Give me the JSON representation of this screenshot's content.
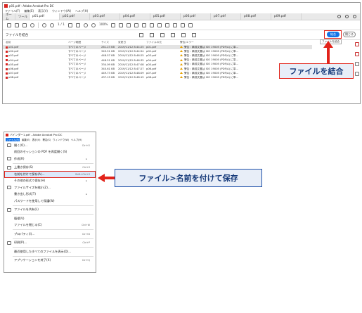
{
  "top": {
    "window_title": "p01.pdf - Adobe Acrobat Pro DC",
    "menu": [
      "ファイル(F)",
      "編集(E)",
      "表示(V)",
      "ウィンドウ(W)",
      "ヘルプ(H)"
    ],
    "tabs": [
      "ホーム",
      "ツール",
      "p01.pdf",
      "p02.pdf",
      "p03.pdf",
      "p04.pdf",
      "p05.pdf",
      "p06.pdf",
      "p07.pdf",
      "p08.pdf",
      "p09.pdf"
    ],
    "zoom": "100%",
    "page_indicator": "1 / 1",
    "combine_title": "ファイルを結合",
    "combine_button": "結合",
    "close_button": "閉じる",
    "tooltip": "ファイルを結合",
    "columns": [
      "名前",
      "ページ範囲",
      "サイズ",
      "変更日",
      "ファイルの元",
      "警告/エラー"
    ],
    "files": [
      {
        "name": "p01.pdf",
        "pages": "すべてのページ",
        "size": "261.23 KB",
        "modified": "2019/11/12 8:44:25",
        "origin": "p01.pdf",
        "warning": "警告：精成文書は ISO 19005 (PDF/A) に準..."
      },
      {
        "name": "p02.pdf",
        "pages": "すべてのページ",
        "size": "349.51 KB",
        "modified": "2019/11/12 8:44:54",
        "origin": "p02.pdf",
        "warning": "警告：精成文書は ISO 19005 (PDF/A) に準..."
      },
      {
        "name": "p03.pdf",
        "pages": "すべてのページ",
        "size": "448.57 KB",
        "modified": "2019/11/12 8:46:25",
        "origin": "p03.pdf",
        "warning": "警告：精成文書は ISO 19005 (PDF/A) に準..."
      },
      {
        "name": "p04.pdf",
        "pages": "すべてのページ",
        "size": "448.51 KB",
        "modified": "2019/11/12 8:46:35",
        "origin": "p04.pdf",
        "warning": "警告：精成文書は ISO 19005 (PDF/A) に準..."
      },
      {
        "name": "p05.pdf",
        "pages": "すべてのページ",
        "size": "334.09 KB",
        "modified": "2019/11/12 8:47:08",
        "origin": "p05.pdf",
        "warning": "警告：精成文書は ISO 19005 (PDF/A) に準..."
      },
      {
        "name": "p06.pdf",
        "pages": "すべてのページ",
        "size": "340.61 KB",
        "modified": "2019/11/12 8:47:27",
        "origin": "p06.pdf",
        "warning": "警告：精成文書は ISO 19005 (PDF/A) に準..."
      },
      {
        "name": "p07.pdf",
        "pages": "すべてのページ",
        "size": "449.73 KB",
        "modified": "2019/11/12 8:48:09",
        "origin": "p07.pdf",
        "warning": "警告：精成文書は ISO 19005 (PDF/A) に準..."
      },
      {
        "name": "p08.pdf",
        "pages": "すべてのページ",
        "size": "437.15 KB",
        "modified": "2019/11/12 8:48:15",
        "origin": "p08.pdf",
        "warning": "警告：精成文書は ISO 19005 (PDF/A) に準..."
      }
    ],
    "callout": "ファイルを結合"
  },
  "menu_shot": {
    "window_title": "バインダー1.pdf - Adobe Acrobat Pro DC",
    "menubar": [
      "ファイル(F)",
      "編集(E)",
      "表示(V)",
      "署名(S)",
      "ウィンドウ(W)",
      "ヘルプ(H)"
    ],
    "items": [
      {
        "label": "開く(O)...",
        "shortcut": "Ctrl+O",
        "icon": "folder-icon"
      },
      {
        "label": "前回のセッションの PDF を再度開く(S)",
        "shortcut": "",
        "icon": ""
      },
      {
        "label": "作成(R)",
        "shortcut": "",
        "icon": "create-pdf-icon",
        "submenu": "▸"
      },
      {
        "label": "上書き保存(S)",
        "shortcut": "Ctrl+S",
        "icon": "save-icon",
        "sep_before": true
      },
      {
        "label": "名前を付けて保存(A)...",
        "shortcut": "Shift+Ctrl+S",
        "icon": "",
        "highlight": true
      },
      {
        "label": "その他の形式で保存(H)",
        "shortcut": "",
        "icon": "",
        "submenu": "▸"
      },
      {
        "label": "ファイルサイズを縮小(Z)...",
        "shortcut": "",
        "icon": "compress-icon"
      },
      {
        "label": "書き出し形式(T)",
        "shortcut": "",
        "icon": "",
        "submenu": "▸"
      },
      {
        "label": "パスワードを使用して保護(W)",
        "shortcut": "",
        "icon": ""
      },
      {
        "label": "ファイルを共有(L)",
        "shortcut": "",
        "icon": "share-icon",
        "sep_before": true
      },
      {
        "label": "復帰(V)",
        "shortcut": "",
        "icon": "",
        "sep_before": true
      },
      {
        "label": "ファイルを閉じる(C)",
        "shortcut": "Ctrl+W",
        "icon": ""
      },
      {
        "label": "プロパティ(I)...",
        "shortcut": "Ctrl+D",
        "icon": "",
        "sep_before": true
      },
      {
        "label": "印刷(P)...",
        "shortcut": "Ctrl+P",
        "icon": "print-icon",
        "sep_before": true
      },
      {
        "label": "最近使用したすべてのファイルを表示(D)...",
        "shortcut": "",
        "icon": "",
        "sep_before": true
      },
      {
        "label": "アプリケーションを終了(X)",
        "shortcut": "Ctrl+Q",
        "icon": "",
        "sep_before": true
      }
    ],
    "callout": "ファイル>名前を付けて保存"
  },
  "colors": {
    "accent": "#1473e6",
    "highlight": "#e2231a",
    "callout_text": "#163a7a"
  }
}
